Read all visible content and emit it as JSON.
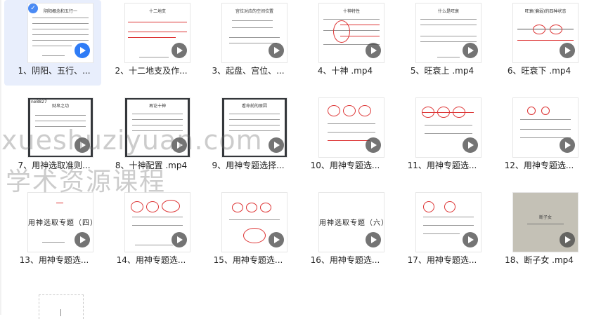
{
  "files": [
    {
      "label": "1、阴阳、五行、...",
      "selected": true
    },
    {
      "label": "2、十二地支及作..."
    },
    {
      "label": "3、起盘、宫位、..."
    },
    {
      "label": "4、十神 .mp4"
    },
    {
      "label": "5、旺衰上 .mp4"
    },
    {
      "label": "6、旺衰下 .mp4"
    },
    {
      "label": "7、用神选取准则..."
    },
    {
      "label": "8、十神配置 .mp4"
    },
    {
      "label": "9、用神专题选择..."
    },
    {
      "label": "10、用神专题选..."
    },
    {
      "label": "11、用神专题选..."
    },
    {
      "label": "12、用神专题选..."
    },
    {
      "label": "13、用神专题选..."
    },
    {
      "label": "14、用神专题选..."
    },
    {
      "label": "15、用神专题选..."
    },
    {
      "label": "16、用神专题选..."
    },
    {
      "label": "17、用神专题选..."
    },
    {
      "label": "18、断子女 .mp4"
    }
  ],
  "thumb_text": {
    "t1": "阴阳概念和五行一",
    "t2": "十二地支",
    "t3": "宫位对应的空间位置",
    "t4": "十神特性",
    "t5": "什么是旺衰",
    "t6": "旺衰(偏弱)的四种状态",
    "t7": "财帛之功",
    "t7code": "ne8827",
    "t8": "再论十神",
    "t9": "看命前的原因",
    "t13": "用神选取专题（四）",
    "t16": "用神选取专题（六）",
    "t18": "断子女"
  },
  "watermark": {
    "line1": "xueshuziyuan.com",
    "line2": "学术资源课程"
  },
  "colors": {
    "selected_bg": "#e8eefc",
    "accent": "#2f7cf6",
    "annotation_red": "#d33333"
  }
}
